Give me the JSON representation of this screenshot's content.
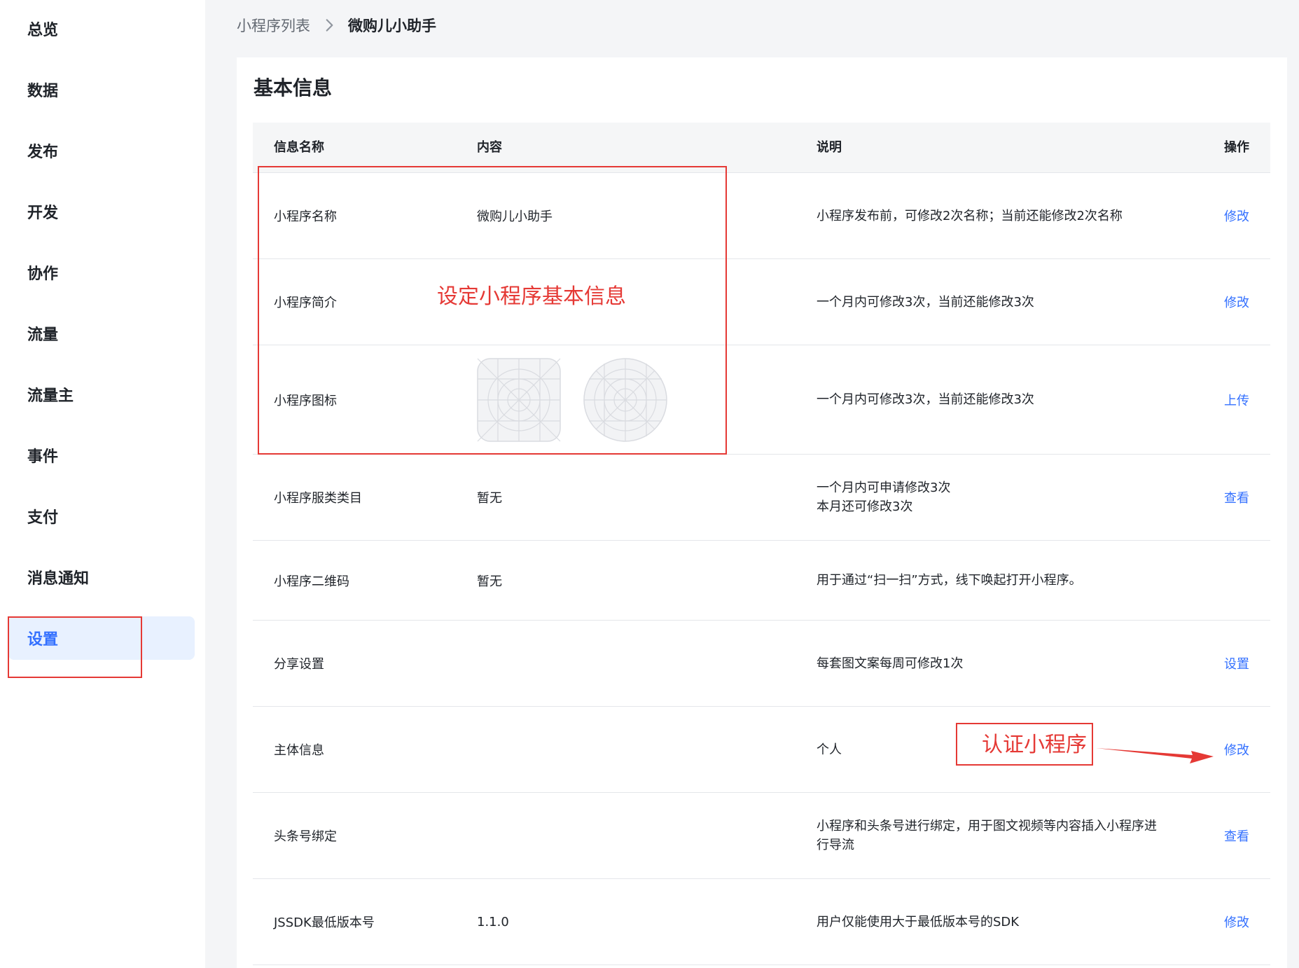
{
  "sidebar": {
    "items": [
      {
        "label": "总览"
      },
      {
        "label": "数据"
      },
      {
        "label": "发布"
      },
      {
        "label": "开发"
      },
      {
        "label": "协作"
      },
      {
        "label": "流量"
      },
      {
        "label": "流量主"
      },
      {
        "label": "事件"
      },
      {
        "label": "支付"
      },
      {
        "label": "消息通知"
      },
      {
        "label": "设置",
        "active": true
      }
    ]
  },
  "breadcrumb": {
    "parent": "小程序列表",
    "current": "微购儿小助手",
    "separator_icon": "chevron-right-icon"
  },
  "section": {
    "title": "基本信息"
  },
  "table": {
    "headers": {
      "name": "信息名称",
      "content": "内容",
      "desc": "说明",
      "op": "操作"
    },
    "rows": [
      {
        "name": "小程序名称",
        "content": "微购儿小助手",
        "desc": "小程序发布前，可修改2次名称；当前还能修改2次名称",
        "op": "修改"
      },
      {
        "name": "小程序简介",
        "content": "",
        "desc": "一个月内可修改3次，当前还能修改3次",
        "op": "修改"
      },
      {
        "name": "小程序图标",
        "content": "",
        "desc": "一个月内可修改3次，当前还能修改3次",
        "op": "上传"
      },
      {
        "name": "小程序服类类目",
        "content": "暂无",
        "desc_line1": "一个月内可申请修改3次",
        "desc_line2": "本月还可修改3次",
        "op": "查看"
      },
      {
        "name": "小程序二维码",
        "content": "暂无",
        "desc": "用于通过“扫一扫”方式，线下唤起打开小程序。",
        "op": ""
      },
      {
        "name": "分享设置",
        "content": "",
        "desc": "每套图文案每周可修改1次",
        "op": "设置"
      },
      {
        "name": "主体信息",
        "content": "",
        "desc": "个人",
        "op": "修改"
      },
      {
        "name": "头条号绑定",
        "content": "",
        "desc_line1": "小程序和头条号进行绑定，用于图文视频等内容插入小程序进",
        "desc_line2": "行导流",
        "op": "查看"
      },
      {
        "name": "JSSDK最低版本号",
        "content": "1.1.0",
        "desc": "用户仅能使用大于最低版本号的SDK",
        "op": "修改"
      }
    ]
  },
  "annotations": {
    "basic_info": "设定小程序基本信息",
    "certify": "认证小程序"
  },
  "colors": {
    "accent": "#3370ff",
    "annotation": "#e53935",
    "active_bg": "#e8f1ff"
  }
}
